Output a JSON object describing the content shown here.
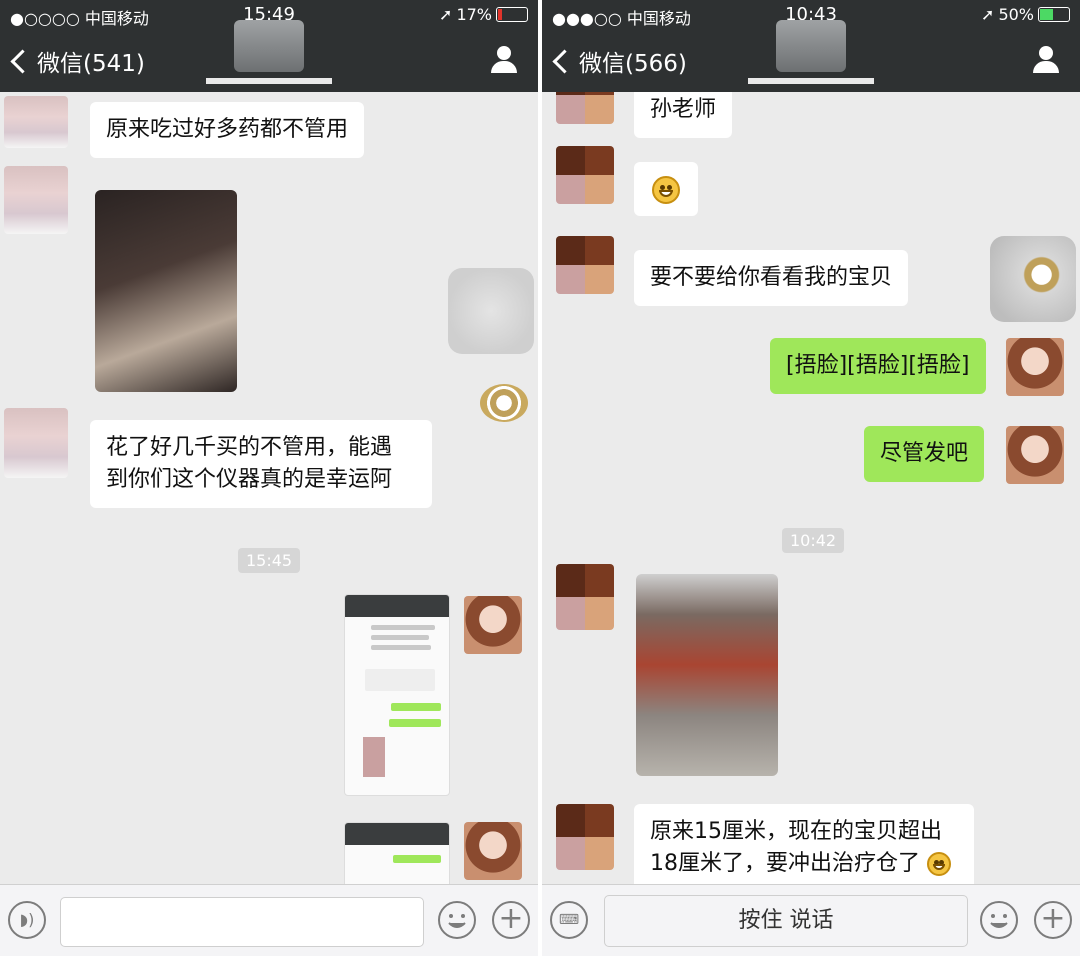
{
  "left": {
    "status": {
      "carrier": "●○○○○ 中国移动 ",
      "time": "15:49",
      "battery": "17%",
      "battery_color": "#e0342b",
      "battery_level": 0.17
    },
    "nav": {
      "back": "微信(541)"
    },
    "messages": {
      "m1": "原来吃过好多药都不管用",
      "m2": "花了好几千买的不管用，能遇到你们这个仪器真的是幸运阿",
      "m2_line1": "花了好几千买的不管用，能遇",
      "m2_line2": "到你们这个仪器真的是幸运阿"
    },
    "time_chip": "15:45"
  },
  "right": {
    "status": {
      "carrier": "●●●○○ 中国移动 ",
      "time": "10:43",
      "battery": "50%",
      "battery_color": "#4cd964",
      "battery_level": 0.5
    },
    "nav": {
      "back": "微信(566)"
    },
    "messages": {
      "m1": "孙老师",
      "m3": "要不要给你看看我的宝贝",
      "m4": "[捂脸][捂脸][捂脸]",
      "m5": "尽管发吧",
      "m6_line1": "原来15厘米，现在的宝贝超出",
      "m6_line2": "18厘米了，要冲出治疗仓了"
    },
    "time_chip": "10:42",
    "talk_button": "按住 说话"
  }
}
